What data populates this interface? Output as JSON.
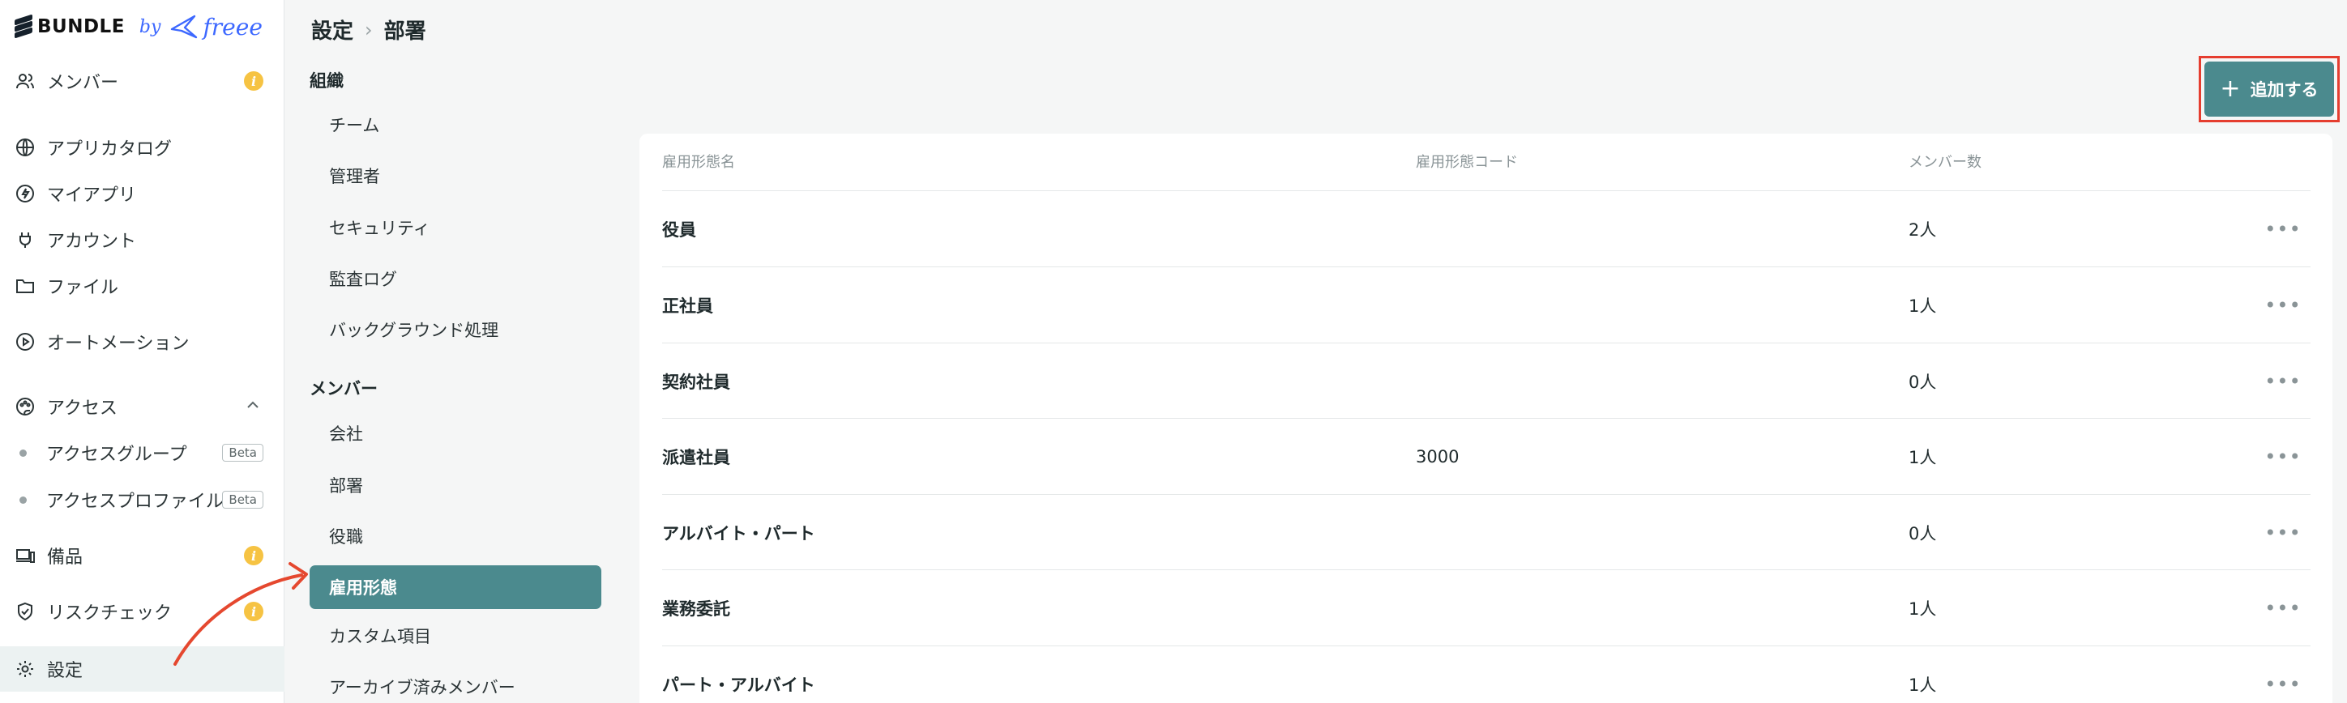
{
  "brand": {
    "name": "BUNDLE",
    "by": "by",
    "partner": "freee"
  },
  "sidebar": {
    "items": [
      {
        "label": "メンバー",
        "icon": "users-icon",
        "badge": "i"
      },
      {
        "label": "アプリカタログ",
        "icon": "globe-icon"
      },
      {
        "label": "マイアプリ",
        "icon": "bolt-icon"
      },
      {
        "label": "アカウント",
        "icon": "plug-icon"
      },
      {
        "label": "ファイル",
        "icon": "folder-icon"
      },
      {
        "label": "オートメーション",
        "icon": "play-circle-icon"
      },
      {
        "label": "アクセス",
        "icon": "palette-icon"
      },
      {
        "label": "アクセスグループ",
        "badge": "Beta"
      },
      {
        "label": "アクセスプロファイル",
        "badge": "Beta"
      },
      {
        "label": "備品",
        "icon": "devices-icon",
        "badge": "i"
      },
      {
        "label": "リスクチェック",
        "icon": "shield-check-icon",
        "badge": "i"
      },
      {
        "label": "設定",
        "icon": "gear-icon"
      }
    ]
  },
  "breadcrumb": {
    "root": "設定",
    "separator": "›",
    "current": "部署"
  },
  "settings_menu": {
    "org_title": "組織",
    "org_items": [
      "チーム",
      "管理者",
      "セキュリティ",
      "監査ログ",
      "バックグラウンド処理"
    ],
    "member_title": "メンバー",
    "member_items": [
      "会社",
      "部署",
      "役職",
      "雇用形態",
      "カスタム項目",
      "アーカイブ済みメンバー"
    ]
  },
  "add_button": {
    "label": "追加する",
    "icon": "plus-icon"
  },
  "table": {
    "columns": [
      "雇用形態名",
      "雇用形態コード",
      "メンバー数"
    ],
    "rows": [
      {
        "name": "役員",
        "code": "",
        "count": "2人"
      },
      {
        "name": "正社員",
        "code": "",
        "count": "1人"
      },
      {
        "name": "契約社員",
        "code": "",
        "count": "0人"
      },
      {
        "name": "派遣社員",
        "code": "3000",
        "count": "1人"
      },
      {
        "name": "アルバイト・パート",
        "code": "",
        "count": "0人"
      },
      {
        "name": "業務委託",
        "code": "",
        "count": "1人"
      },
      {
        "name": "パート・アルバイト",
        "code": "",
        "count": "1人"
      }
    ],
    "more": "•••"
  },
  "colors": {
    "accent": "#4b8a8e",
    "highlight": "#e53d2f",
    "badge": "#f6c343"
  }
}
